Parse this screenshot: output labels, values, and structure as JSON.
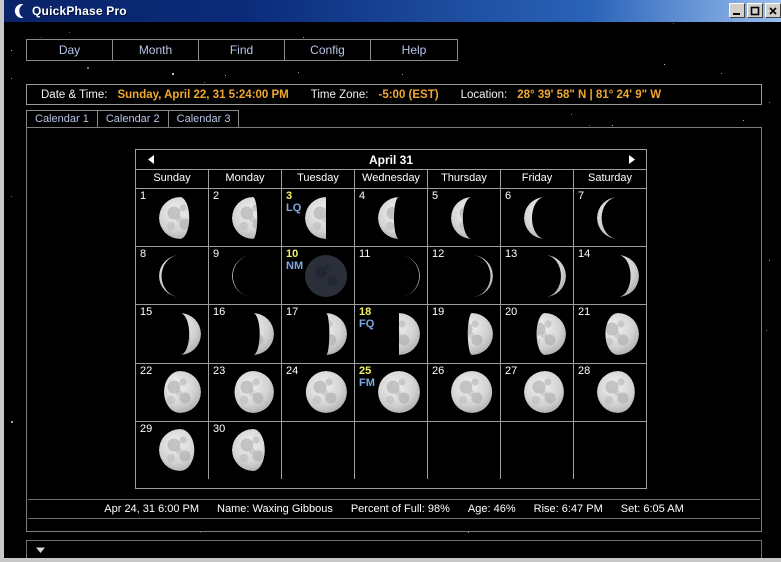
{
  "window": {
    "title": "QuickPhase Pro",
    "icon": "crescent-moon-icon",
    "minimize_label": "_",
    "maximize_label": "□",
    "close_label": "X"
  },
  "nav": {
    "buttons": [
      {
        "label": "Day"
      },
      {
        "label": "Month"
      },
      {
        "label": "Find"
      },
      {
        "label": "Config"
      },
      {
        "label": "Help"
      }
    ]
  },
  "info_bar": {
    "datetime_label": "Date & Time:",
    "datetime_value": "Sunday, April 22, 31  5:24:00 PM",
    "timezone_label": "Time Zone:",
    "timezone_value": "-5:00 (EST)",
    "location_label": "Location:",
    "location_value": "28° 39' 58\" N  |  81° 24' 9\" W"
  },
  "tabs": [
    {
      "label": "Calendar 1"
    },
    {
      "label": "Calendar 2"
    },
    {
      "label": "Calendar 3"
    }
  ],
  "calendar": {
    "title": "April 31",
    "prev_label": "◀",
    "next_label": "▶",
    "day_headers": [
      "Sunday",
      "Monday",
      "Tuesday",
      "Wednesday",
      "Thursday",
      "Friday",
      "Saturday"
    ],
    "weeks": [
      [
        {
          "day": "1",
          "phase_label": "",
          "illum": 0.72,
          "waxing": false
        },
        {
          "day": "2",
          "phase_label": "",
          "illum": 0.6,
          "waxing": false
        },
        {
          "day": "3",
          "phase_label": "LQ",
          "illum": 0.5,
          "waxing": false
        },
        {
          "day": "4",
          "phase_label": "",
          "illum": 0.38,
          "waxing": false
        },
        {
          "day": "5",
          "phase_label": "",
          "illum": 0.28,
          "waxing": false
        },
        {
          "day": "6",
          "phase_label": "",
          "illum": 0.19,
          "waxing": false
        },
        {
          "day": "7",
          "phase_label": "",
          "illum": 0.11,
          "waxing": false
        }
      ],
      [
        {
          "day": "8",
          "phase_label": "",
          "illum": 0.06,
          "waxing": false
        },
        {
          "day": "9",
          "phase_label": "",
          "illum": 0.02,
          "waxing": false
        },
        {
          "day": "10",
          "phase_label": "NM",
          "illum": 0.0,
          "waxing": true
        },
        {
          "day": "11",
          "phase_label": "",
          "illum": 0.02,
          "waxing": true
        },
        {
          "day": "12",
          "phase_label": "",
          "illum": 0.06,
          "waxing": true
        },
        {
          "day": "13",
          "phase_label": "",
          "illum": 0.12,
          "waxing": true
        },
        {
          "day": "14",
          "phase_label": "",
          "illum": 0.2,
          "waxing": true
        }
      ],
      [
        {
          "day": "15",
          "phase_label": "",
          "illum": 0.28,
          "waxing": true
        },
        {
          "day": "16",
          "phase_label": "",
          "illum": 0.34,
          "waxing": true
        },
        {
          "day": "17",
          "phase_label": "",
          "illum": 0.42,
          "waxing": true
        },
        {
          "day": "18",
          "phase_label": "FQ",
          "illum": 0.5,
          "waxing": true
        },
        {
          "day": "19",
          "phase_label": "",
          "illum": 0.6,
          "waxing": true
        },
        {
          "day": "20",
          "phase_label": "",
          "illum": 0.7,
          "waxing": true
        },
        {
          "day": "21",
          "phase_label": "",
          "illum": 0.8,
          "waxing": true
        }
      ],
      [
        {
          "day": "22",
          "phase_label": "",
          "illum": 0.88,
          "waxing": true
        },
        {
          "day": "23",
          "phase_label": "",
          "illum": 0.94,
          "waxing": true
        },
        {
          "day": "24",
          "phase_label": "",
          "illum": 0.98,
          "waxing": true
        },
        {
          "day": "25",
          "phase_label": "FM",
          "illum": 1.0,
          "waxing": true
        },
        {
          "day": "26",
          "phase_label": "",
          "illum": 0.98,
          "waxing": false
        },
        {
          "day": "27",
          "phase_label": "",
          "illum": 0.95,
          "waxing": false
        },
        {
          "day": "28",
          "phase_label": "",
          "illum": 0.9,
          "waxing": false
        }
      ],
      [
        {
          "day": "29",
          "phase_label": "",
          "illum": 0.84,
          "waxing": false
        },
        {
          "day": "30",
          "phase_label": "",
          "illum": 0.78,
          "waxing": false
        },
        {
          "day": "",
          "phase_label": "",
          "illum": null,
          "waxing": false
        },
        {
          "day": "",
          "phase_label": "",
          "illum": null,
          "waxing": false
        },
        {
          "day": "",
          "phase_label": "",
          "illum": null,
          "waxing": false
        },
        {
          "day": "",
          "phase_label": "",
          "illum": null,
          "waxing": false
        },
        {
          "day": "",
          "phase_label": "",
          "illum": null,
          "waxing": false
        }
      ]
    ]
  },
  "status": {
    "date": "Apr 24, 31 6:00 PM",
    "name_label": "Name:",
    "name_value": "Waxing Gibbous",
    "percent_label": "Percent of Full:",
    "percent_value": "98%",
    "age_label": "Age:",
    "age_value": "46%",
    "rise_label": "Rise:",
    "rise_value": "6:47 PM",
    "set_label": "Set:",
    "set_value": "6:05 AM"
  },
  "expander": {
    "icon": "chevron-down-icon"
  },
  "colors": {
    "accent_orange": "#f0a830",
    "nav_text": "#b8c4e8",
    "special_day": "#f5f06a",
    "phase_label": "#7ea8e0",
    "titlebar_start": "#0a246a",
    "titlebar_end": "#9cc0f0"
  }
}
